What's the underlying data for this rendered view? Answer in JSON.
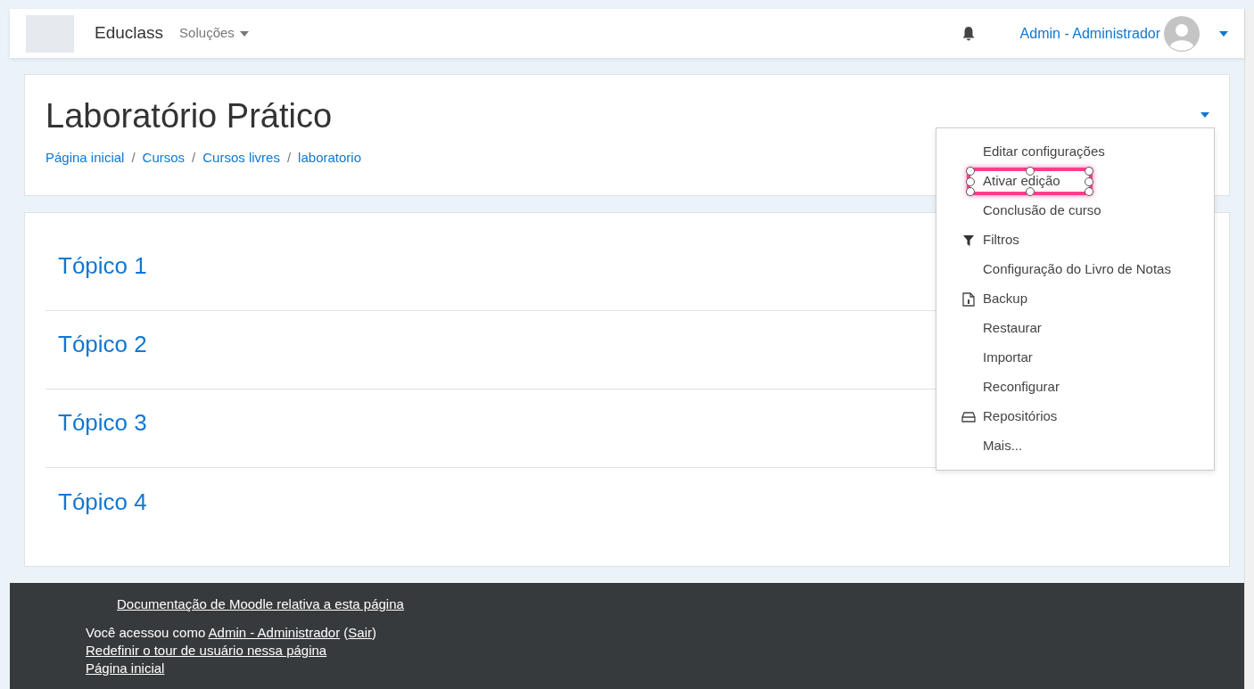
{
  "navbar": {
    "brand": "Educlass",
    "menu": "Soluções",
    "user": "Admin - Administrador"
  },
  "header": {
    "title": "Laboratório Prático",
    "breadcrumb": [
      "Página inicial",
      "Cursos",
      "Cursos livres",
      "laboratorio"
    ],
    "separators": [
      "/",
      "/",
      "/"
    ]
  },
  "action_menu": {
    "items": [
      {
        "label": "Editar configurações",
        "kind": "plain",
        "highlighted": false
      },
      {
        "label": "Ativar edição",
        "kind": "plain",
        "highlighted": true
      },
      {
        "label": "Conclusão de curso",
        "kind": "plain",
        "highlighted": false
      },
      {
        "label": "Filtros",
        "kind": "filter",
        "highlighted": false
      },
      {
        "label": "Configuração do Livro de Notas",
        "kind": "plain",
        "highlighted": false
      },
      {
        "label": "Backup",
        "kind": "backup",
        "highlighted": false
      },
      {
        "label": "Restaurar",
        "kind": "plain",
        "highlighted": false
      },
      {
        "label": "Importar",
        "kind": "plain",
        "highlighted": false
      },
      {
        "label": "Reconfigurar",
        "kind": "plain",
        "highlighted": false
      },
      {
        "label": "Repositórios",
        "kind": "repository",
        "highlighted": false
      },
      {
        "label": "Mais...",
        "kind": "plain",
        "highlighted": false
      }
    ]
  },
  "topics": [
    "Tópico 1",
    "Tópico 2",
    "Tópico 3",
    "Tópico 4"
  ],
  "footer": {
    "docs_link": "Documentação de Moodle relativa a esta página",
    "login_prefix": "Você acessou como ",
    "login_user": "Admin - Administrador",
    "login_open": " (",
    "logout": "Sair",
    "login_close": ")",
    "tour_link": "Redefinir o tour de usuário nessa página",
    "home_link": "Página inicial"
  }
}
